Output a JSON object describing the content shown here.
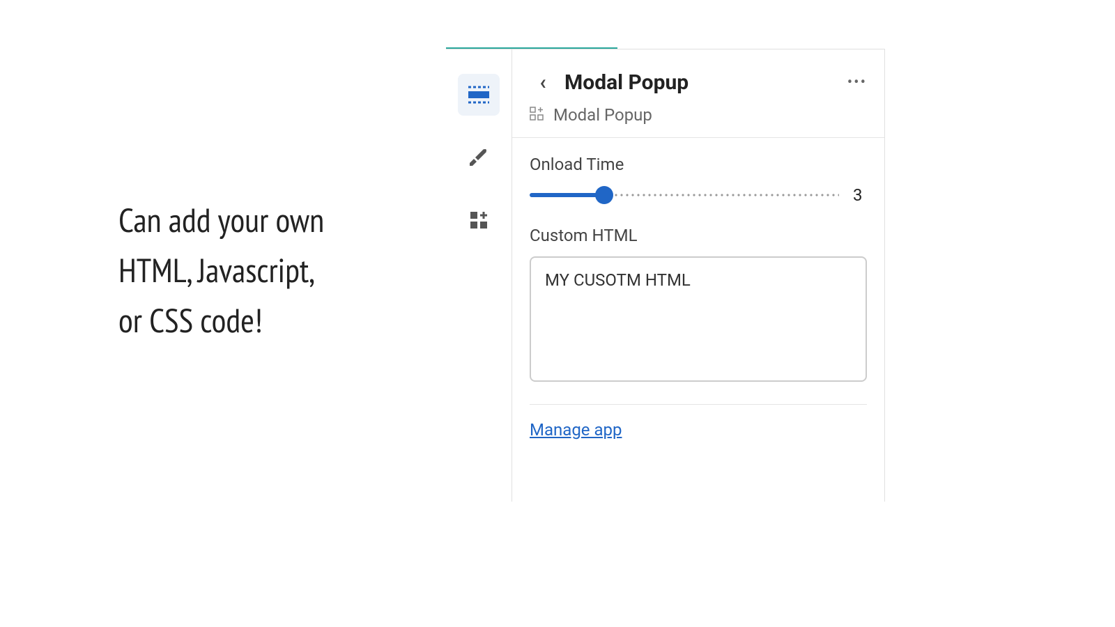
{
  "caption": "Can add your own\nHTML, Javascript,\nor CSS code!",
  "header": {
    "title": "Modal Popup"
  },
  "breadcrumb": {
    "label": "Modal Popup"
  },
  "fields": {
    "onload_time_label": "Onload Time",
    "onload_time_value": "3",
    "custom_html_label": "Custom HTML",
    "custom_html_value": "MY CUSOTM HTML"
  },
  "footer": {
    "manage_link": "Manage app"
  },
  "colors": {
    "accent_teal": "#2aa79b",
    "accent_blue": "#2066c6"
  }
}
